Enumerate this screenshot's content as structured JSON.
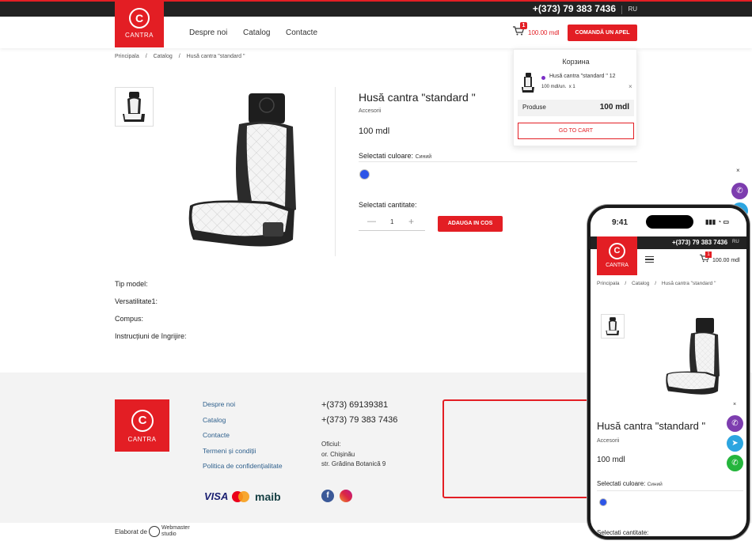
{
  "topbar": {
    "phone": "+(373) 79 383 7436",
    "lang": "RU"
  },
  "brand": {
    "name": "CANTRA",
    "letter": "C"
  },
  "nav": [
    {
      "label": "Despre noi"
    },
    {
      "label": "Catalog"
    },
    {
      "label": "Contacte"
    }
  ],
  "header": {
    "cart_count": "1",
    "cart_total": "100.00 mdl",
    "call_label": "COMANDĂ UN APEL"
  },
  "breadcrumb": [
    "Principala",
    "/",
    "Catalog",
    "/",
    "Husă cantra \"standard \""
  ],
  "product": {
    "title": "Husă cantra \"standard \"",
    "category": "Accesorii",
    "price": "100 mdl",
    "color_label": "Selectati culoare:",
    "color_value": "Синий",
    "color_hex": "#2d55e8",
    "qty_label": "Selectati cantitate:",
    "qty_minus": "—",
    "qty_value": "1",
    "qty_plus": "+",
    "add_label": "ADAUGA IN COS"
  },
  "specs": [
    "Tip model:",
    "Versatilitate1:",
    "Compus:",
    "Instrucțiuni de îngrijire:"
  ],
  "mini_cart": {
    "title": "Корзина",
    "item_name": "Husă cantra \"standard \" 12",
    "item_price": "100 mdl/un.",
    "item_qty": "x 1",
    "close": "×",
    "total_label": "Produse",
    "total_value": "100 mdl",
    "go_label": "GO TO CART"
  },
  "side": {
    "close": "×"
  },
  "footer": {
    "links": [
      "Despre noi",
      "Catalog",
      "Contacte",
      "Termeni și condiții",
      "Politica de confidențialitate"
    ],
    "phones": [
      "+(373) 69139381",
      "+(373) 79 383 7436"
    ],
    "office_label": "Oficiul:",
    "city": "or. Chișinău",
    "street": "str. Grădina Botanică 9",
    "visa": "VISA",
    "maib": "maib",
    "fb": "f"
  },
  "credit": {
    "label": "Elaborat de",
    "studio_top": "Webmaster",
    "studio_bottom": "studio"
  },
  "phone": {
    "time": "9:41",
    "status_icons": "▮▮▮ ◔ ▭",
    "phone_number": "+(373) 79 383 7436",
    "lang": "RU",
    "cart_count": "1",
    "cart_total": "100.00 mdl",
    "breadcrumb": [
      "Principala",
      "/",
      "Catalog",
      "/",
      "Husă cantra \"standard \""
    ],
    "close": "×",
    "title": "Husă cantra \"standard \"",
    "category": "Accesorii",
    "price": "100 mdl",
    "color_label": "Selectati culoare:",
    "color_value": "Синий",
    "qty_label": "Selectati cantitate:"
  },
  "colors": {
    "accent": "#e31e24",
    "viber": "#7d3daf",
    "telegram": "#2ca5e0",
    "whatsapp": "#25b53c"
  },
  "icons": [
    "cart-icon",
    "viber-icon",
    "telegram-icon",
    "whatsapp-icon",
    "facebook-icon",
    "instagram-icon",
    "close-icon",
    "menu-icon"
  ]
}
